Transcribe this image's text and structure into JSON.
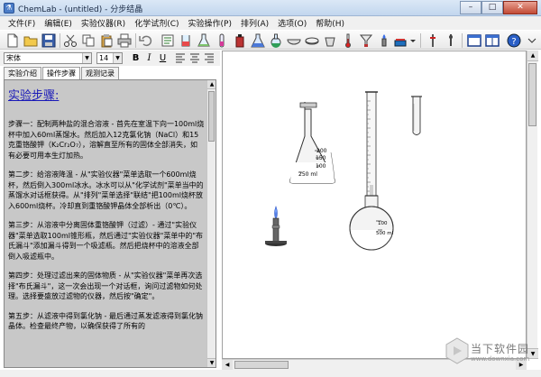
{
  "window": {
    "title": "ChemLab - (untitled) - 分步结晶",
    "minimize": "–",
    "maximize": "□",
    "close": "✕"
  },
  "menu": [
    "文件(F)",
    "编辑(E)",
    "实验仪器(R)",
    "化学试剂(C)",
    "实验操作(P)",
    "排列(A)",
    "选项(O)",
    "帮助(H)"
  ],
  "format": {
    "font": "宋体",
    "size": "14",
    "bold": "B",
    "italic": "I",
    "underline": "U"
  },
  "tabs": [
    "实验介绍",
    "操作步骤",
    "观测记录"
  ],
  "active_tab": "操作步骤",
  "steps": {
    "heading": "实验步骤:",
    "paragraphs": [
      "步骤一：配制两种盐的混合溶液 - 首先在室温下向一100ml烧杯中加入60ml蒸馏水。然后加入12克氯化钠（NaCl）和15克重铬酸钾（K₂Cr₂O₇），溶解直至所有的固体全部消失，如有必要可用本生灯加热。",
      "第二步：给溶液降温 - 从\"实验仪器\"菜单选取一个600ml烧杯，然后倒入300ml冰水。冰水可以从\"化学试剂\"菜单当中的蒸馏水对话框获得。从\"排列\"菜单选择\"联结\"把100ml烧杯放入600ml烧杯。冷却直到重铬酸钾晶体全部析出（0℃）。",
      "第三步：从溶液中分离固体重铬酸钾（过滤）- 通过\"实验仪器\"菜单选取100ml锥形瓶，然后通过\"实验仪器\"菜单中的\"布氏漏斗\"添加漏斗得到一个吸滤瓶。然后把烧杯中的溶液全部倒入吸滤瓶中。",
      "第四步：处理过滤出来的固体物质 - 从\"实验仪器\"菜单再次选择\"布氏漏斗\"，这一次会出现一个对话框，询问过滤物如何处理。选择要盛放过滤物的仪器，然后按\"确定\"。",
      "第五步：从滤液中得到氯化钠 - 最后通过蒸发滤液得到氯化钠晶体。检查最终产物，以确保获得了所有的"
    ]
  },
  "apparatus": {
    "flask_marks": [
      "200",
      "150",
      "100",
      "250 ml"
    ],
    "cylinder_mark": "100",
    "roundflask_mark": "500 ml"
  },
  "watermark": {
    "text": "当下软件园",
    "sub": "www.downxia.com"
  }
}
